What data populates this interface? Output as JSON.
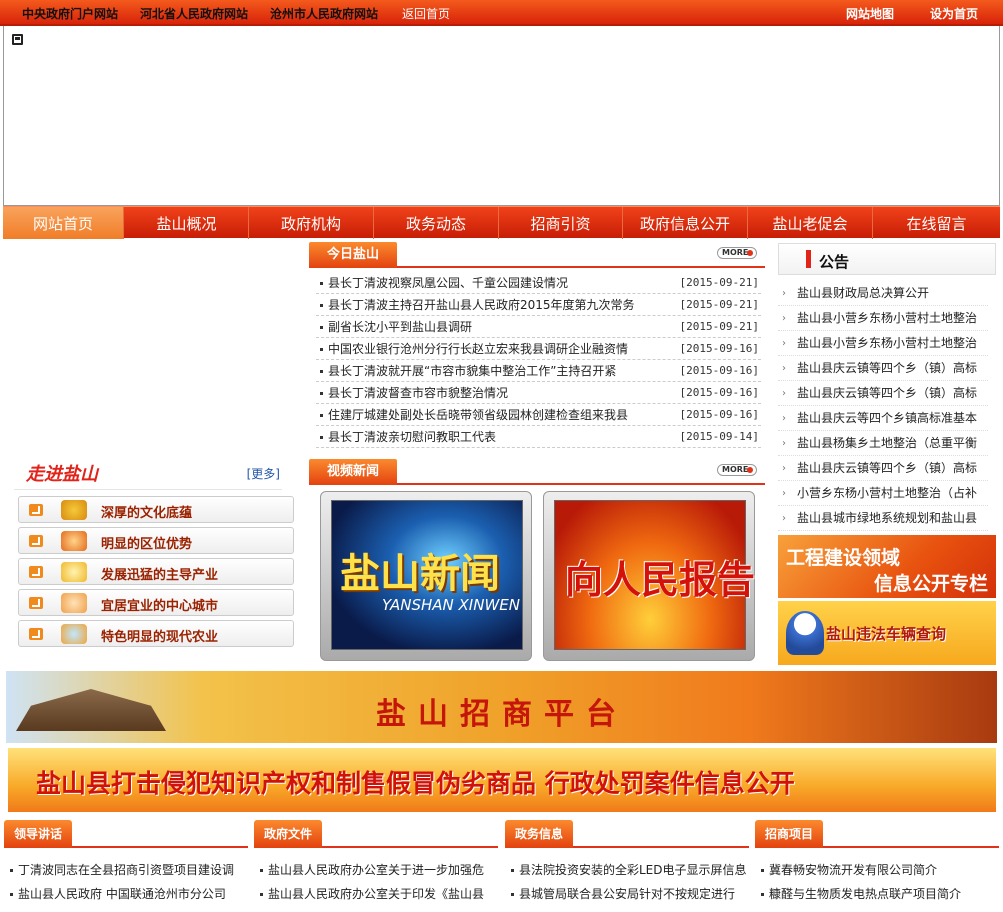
{
  "topbar": {
    "links": [
      "中央政府门户网站",
      "河北省人民政府网站",
      "沧州市人民政府网站",
      "返回首页"
    ],
    "sitemap": "网站地图",
    "sethome": "设为首页"
  },
  "nav": {
    "items": [
      "网站首页",
      "盐山概况",
      "政府机构",
      "政务动态",
      "招商引资",
      "政府信息公开",
      "盐山老促会",
      "在线留言"
    ]
  },
  "today": {
    "title": "今日盐山",
    "more": "MORE",
    "items": [
      {
        "title": "县长丁清波视察凤凰公园、千童公园建设情况",
        "date": "[2015-09-21]"
      },
      {
        "title": "县长丁清波主持召开盐山县人民政府2015年度第九次常务",
        "date": "[2015-09-21]"
      },
      {
        "title": "副省长沈小平到盐山县调研",
        "date": "[2015-09-21]"
      },
      {
        "title": "中国农业银行沧州分行行长赵立宏来我县调研企业融资情",
        "date": "[2015-09-16]"
      },
      {
        "title": "县长丁清波就开展“市容市貌集中整治工作”主持召开紧",
        "date": "[2015-09-16]"
      },
      {
        "title": "县长丁清波督查市容市貌整治情况",
        "date": "[2015-09-16]"
      },
      {
        "title": "住建厅城建处副处长岳晓带领省级园林创建检查组来我县",
        "date": "[2015-09-16]"
      },
      {
        "title": "县长丁清波亲切慰问教职工代表",
        "date": "[2015-09-14]"
      }
    ]
  },
  "video": {
    "title": "视频新闻",
    "more": "MORE",
    "items": [
      {
        "cn": "盐山新闻",
        "en": "YANSHAN XINWEN"
      },
      {
        "cn": "向人民报告"
      }
    ]
  },
  "intro": {
    "title": "走进盐山",
    "more": "[更多]",
    "items": [
      "深厚的文化底蕴",
      "明显的区位优势",
      "发展迅猛的主导产业",
      "宜居宜业的中心城市",
      "特色明显的现代农业"
    ]
  },
  "notice": {
    "title": "公告",
    "items": [
      "盐山县财政局总决算公开",
      "盐山县小营乡东杨小营村土地整治",
      "盐山县小营乡东杨小营村土地整治",
      "盐山县庆云镇等四个乡（镇）高标",
      "盐山县庆云镇等四个乡（镇）高标",
      "盐山县庆云等四个乡镇高标准基本",
      "盐山县杨集乡土地整治（总重平衡",
      "盐山县庆云镇等四个乡（镇）高标",
      "小营乡东杨小营村土地整治（占补",
      "盐山县城市绿地系统规划和盐山县"
    ]
  },
  "side_banners": {
    "b1_line1": "工程建设领域",
    "b1_line2": "信息公开专栏",
    "b2": "盐山违法车辆查询"
  },
  "banners": {
    "invest": "盐山招商平台",
    "ip": "盐山县打击侵犯知识产权和制售假冒伪劣商品  行政处罚案件信息公开"
  },
  "bottom": [
    {
      "title": "领导讲话",
      "items": [
        "丁清波同志在全县招商引资暨项目建设调",
        "盐山县人民政府   中国联通沧州市分公司"
      ]
    },
    {
      "title": "政府文件",
      "items": [
        "盐山县人民政府办公室关于进一步加强危",
        "盐山县人民政府办公室关于印发《盐山县"
      ]
    },
    {
      "title": "政务信息",
      "items": [
        "县法院投资安装的全彩LED电子显示屏信息",
        "县城管局联合县公安局针对不按规定进行"
      ]
    },
    {
      "title": "招商项目",
      "items": [
        "冀春畅安物流开发有限公司简介",
        "糠醛与生物质发电热点联产项目简介"
      ]
    }
  ]
}
